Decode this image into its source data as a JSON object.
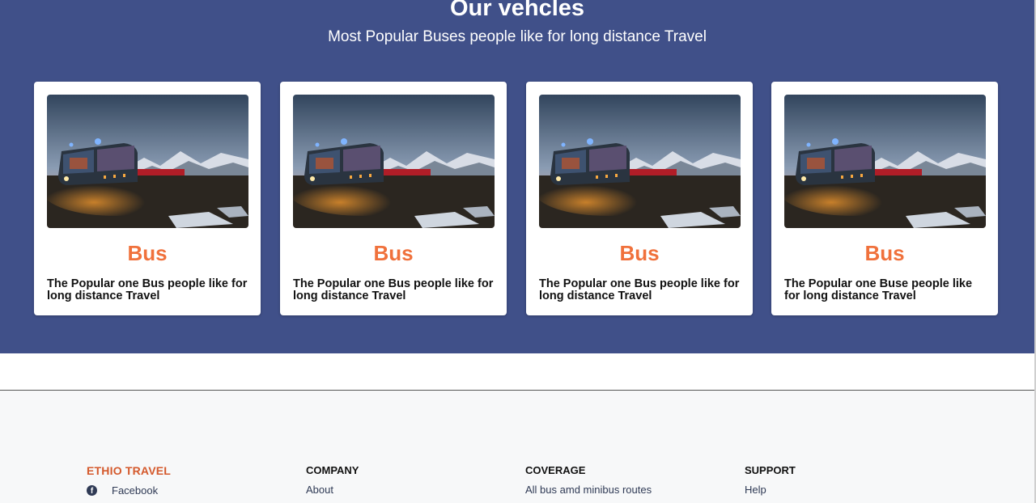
{
  "vehicles": {
    "title": "Our vehcles",
    "subtitle": "Most Popular Buses people like for long distance Travel",
    "cards": [
      {
        "name": "Bus",
        "description": "The Popular one Bus people like for long distance Travel"
      },
      {
        "name": "Bus",
        "description": "The Popular one Bus people like for long distance Travel"
      },
      {
        "name": "Bus",
        "description": "The Popular one Bus people like for long distance Travel"
      },
      {
        "name": "Bus",
        "description": "The Popular one Buse people like for long distance Travel"
      }
    ]
  },
  "footer": {
    "brand": "ETHIO TRAVEL",
    "social": {
      "icon": "facebook-icon",
      "label": "Facebook"
    },
    "columns": [
      {
        "heading": "COMPANY",
        "link": "About"
      },
      {
        "heading": "COVERAGE",
        "link": "All bus amd minibus routes"
      },
      {
        "heading": "SUPPORT",
        "link": "Help"
      }
    ]
  },
  "colors": {
    "section_bg": "#405089",
    "accent": "#f0713c",
    "brand": "#d4592c"
  }
}
